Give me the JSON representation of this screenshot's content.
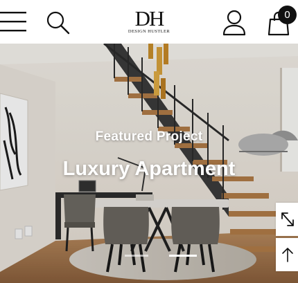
{
  "header": {
    "menu_icon": "hamburger-menu-icon",
    "search_icon": "search-icon",
    "logo": {
      "mark": "DH",
      "tagline": "DESIGN HUSTLER"
    },
    "account_icon": "user-icon",
    "cart_icon": "shopping-bag-icon",
    "cart_count": "0"
  },
  "hero": {
    "kicker": "Featured Project",
    "title": "Luxury Apartment",
    "slides": [
      {
        "active": false
      },
      {
        "active": true
      }
    ]
  },
  "floating": {
    "expand_icon": "expand-arrows-icon",
    "back_to_top_icon": "arrow-up-icon"
  },
  "colors": {
    "text_dark": "#111111",
    "badge_bg": "#111111",
    "hero_text": "#ffffff"
  }
}
